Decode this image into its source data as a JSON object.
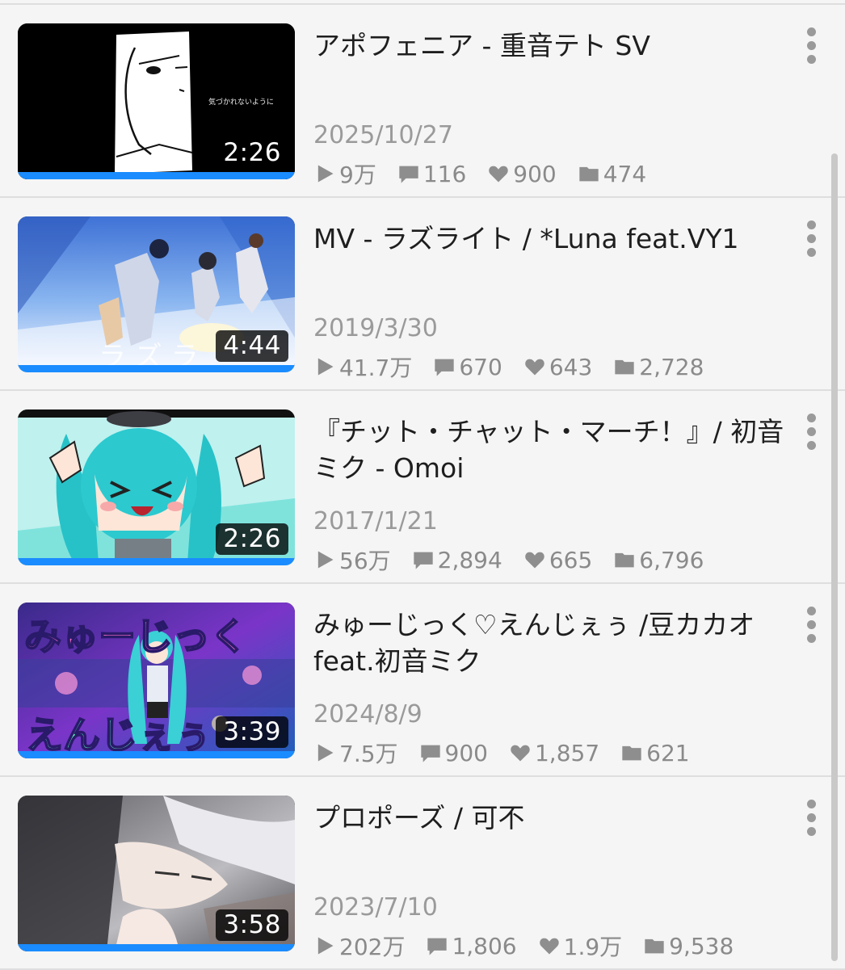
{
  "videos": [
    {
      "title": "アポフェニア - 重音テト SV",
      "date": "2025/10/27",
      "duration": "2:26",
      "views": "9万",
      "comments": "116",
      "likes": "900",
      "mylists": "474",
      "thumb_text": "気づかれないように"
    },
    {
      "title": "MV - ラズライト / *Luna feat.VY1",
      "date": "2019/3/30",
      "duration": "4:44",
      "views": "41.7万",
      "comments": "670",
      "likes": "643",
      "mylists": "2,728",
      "thumb_text": "ラ ズ ラ"
    },
    {
      "title": "『チット・チャット・マーチ！』/ 初音ミク - Omoi",
      "date": "2017/1/21",
      "duration": "2:26",
      "views": "56万",
      "comments": "2,894",
      "likes": "665",
      "mylists": "6,796"
    },
    {
      "title": "みゅーじっく♡えんじぇぅ /豆カカオ feat.初音ミク",
      "date": "2024/8/9",
      "duration": "3:39",
      "views": "7.5万",
      "comments": "900",
      "likes": "1,857",
      "mylists": "621",
      "thumb_text_top": "みゅーじっく",
      "thumb_text_bottom": "えんじぇぅ"
    },
    {
      "title": "プロポーズ / 可不",
      "date": "2023/7/10",
      "duration": "3:58",
      "views": "202万",
      "comments": "1,806",
      "likes": "1.9万",
      "mylists": "9,538"
    }
  ],
  "colors": {
    "progress": "#1a8cff",
    "background": "#f5f5f5",
    "meta_text": "#9a9a9a"
  },
  "icons": {
    "views": "play-icon",
    "comments": "comment-icon",
    "likes": "heart-icon",
    "mylists": "folder-icon",
    "menu": "more-vertical-icon"
  }
}
